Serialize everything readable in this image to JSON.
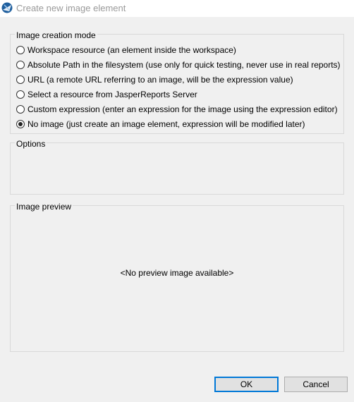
{
  "window": {
    "title": "Create new image element"
  },
  "mode_group": {
    "legend": "Image creation mode",
    "options": [
      {
        "label": "Workspace resource (an element inside the workspace)",
        "selected": false
      },
      {
        "label": "Absolute Path in the filesystem (use only for quick testing, never use in real reports)",
        "selected": false
      },
      {
        "label": "URL (a remote URL referring to an image, will be the expression value)",
        "selected": false
      },
      {
        "label": "Select a resource from JasperReports Server",
        "selected": false
      },
      {
        "label": "Custom expression (enter an expression for the image using the expression editor)",
        "selected": false
      },
      {
        "label": "No image (just create an image element, expression will be modified later)",
        "selected": true
      }
    ]
  },
  "options_group": {
    "legend": "Options"
  },
  "preview_group": {
    "legend": "Image preview",
    "empty_text": "<No preview image available>"
  },
  "buttons": {
    "ok": "OK",
    "cancel": "Cancel"
  },
  "colors": {
    "accent": "#0078d7",
    "background": "#f0f0f0"
  }
}
